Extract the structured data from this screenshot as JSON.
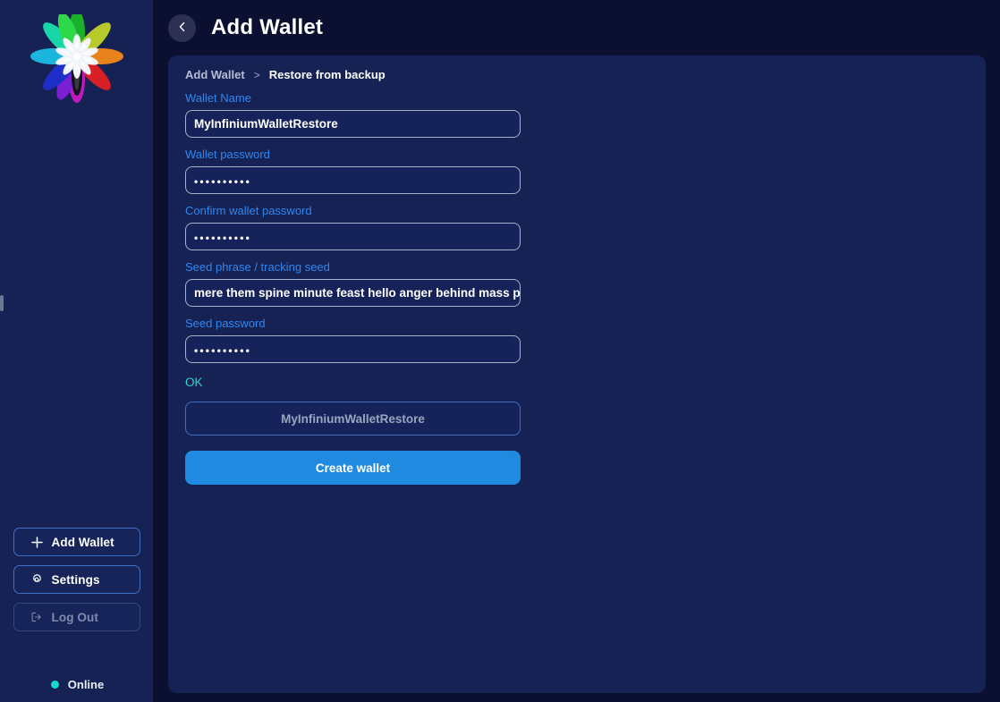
{
  "app": {
    "logo_name": "infinium-flower-logo",
    "background_color": "#0c1030",
    "sidebar_color": "#152253",
    "panel_color": "#152253",
    "accent_color": "#2089e0",
    "label_color": "#2f87ef",
    "ok_color": "#2fd6cb",
    "online_color": "#17d9cf"
  },
  "header": {
    "back_icon": "chevron-left-icon",
    "title": "Add Wallet"
  },
  "breadcrumb": {
    "parent": "Add Wallet",
    "separator": ">",
    "current": "Restore from backup"
  },
  "form": {
    "fields": [
      {
        "label": "Wallet Name",
        "value": "MyInfiniumWalletRestore",
        "type": "text"
      },
      {
        "label": "Wallet password",
        "value": "••••••••••",
        "type": "password"
      },
      {
        "label": "Confirm wallet password",
        "value": "••••••••••",
        "type": "password"
      },
      {
        "label": "Seed phrase / tracking seed",
        "value": "mere them spine minute feast hello anger behind mass poetry...",
        "type": "text"
      },
      {
        "label": "Seed password",
        "value": "••••••••••",
        "type": "password"
      }
    ],
    "status_text": "OK",
    "wallet_name_button": "MyInfiniumWalletRestore",
    "create_button": "Create wallet"
  },
  "sidebar": {
    "buttons": [
      {
        "label": "Add Wallet",
        "icon": "plus-icon",
        "disabled": false
      },
      {
        "label": "Settings",
        "icon": "gear-icon",
        "disabled": false
      },
      {
        "label": "Log Out",
        "icon": "logout-icon",
        "disabled": true
      }
    ],
    "status": {
      "label": "Online",
      "dot": "online-status-dot"
    }
  }
}
